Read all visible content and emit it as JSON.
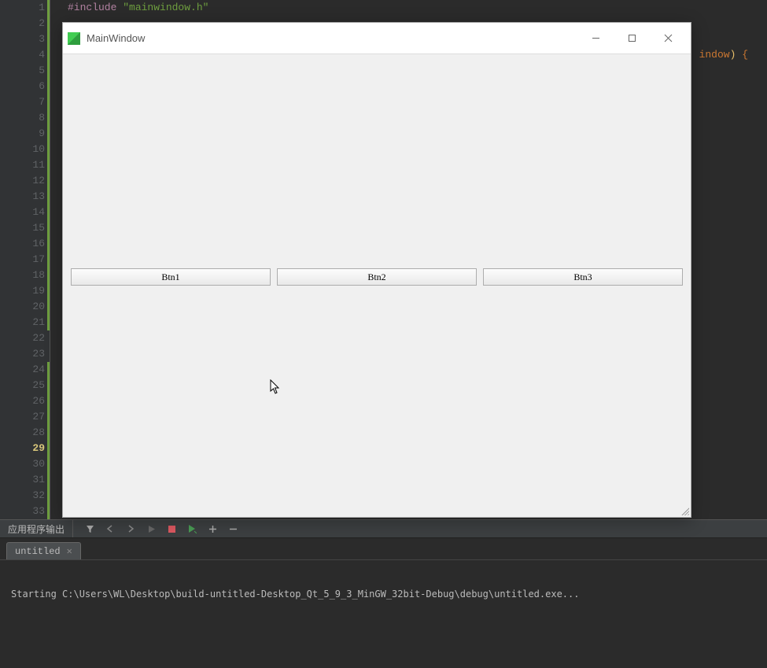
{
  "code": {
    "line1_preproc": "#include",
    "line1_string": " \"mainwindow.h\"",
    "line4_tail_type": "indow",
    "line4_tail_paren": ")",
    "line4_tail_brace": " {"
  },
  "gutter": {
    "lines": [
      "1",
      "2",
      "3",
      "4",
      "5",
      "6",
      "7",
      "8",
      "9",
      "10",
      "11",
      "12",
      "13",
      "14",
      "15",
      "16",
      "17",
      "18",
      "19",
      "20",
      "21",
      "22",
      "23",
      "24",
      "25",
      "26",
      "27",
      "28",
      "29",
      "30",
      "31",
      "32",
      "33"
    ],
    "modified_ranges": [
      [
        1,
        21
      ],
      [
        24,
        33
      ]
    ],
    "fold_lines": [
      4,
      24,
      32
    ],
    "current_line": 29
  },
  "app_window": {
    "title": "MainWindow",
    "buttons": [
      "Btn1",
      "Btn2",
      "Btn3"
    ]
  },
  "output": {
    "panel_title": "应用程序输出",
    "tab_name": "untitled",
    "log_line": "Starting C:\\Users\\WL\\Desktop\\build-untitled-Desktop_Qt_5_9_3_MinGW_32bit-Debug\\debug\\untitled.exe..."
  }
}
